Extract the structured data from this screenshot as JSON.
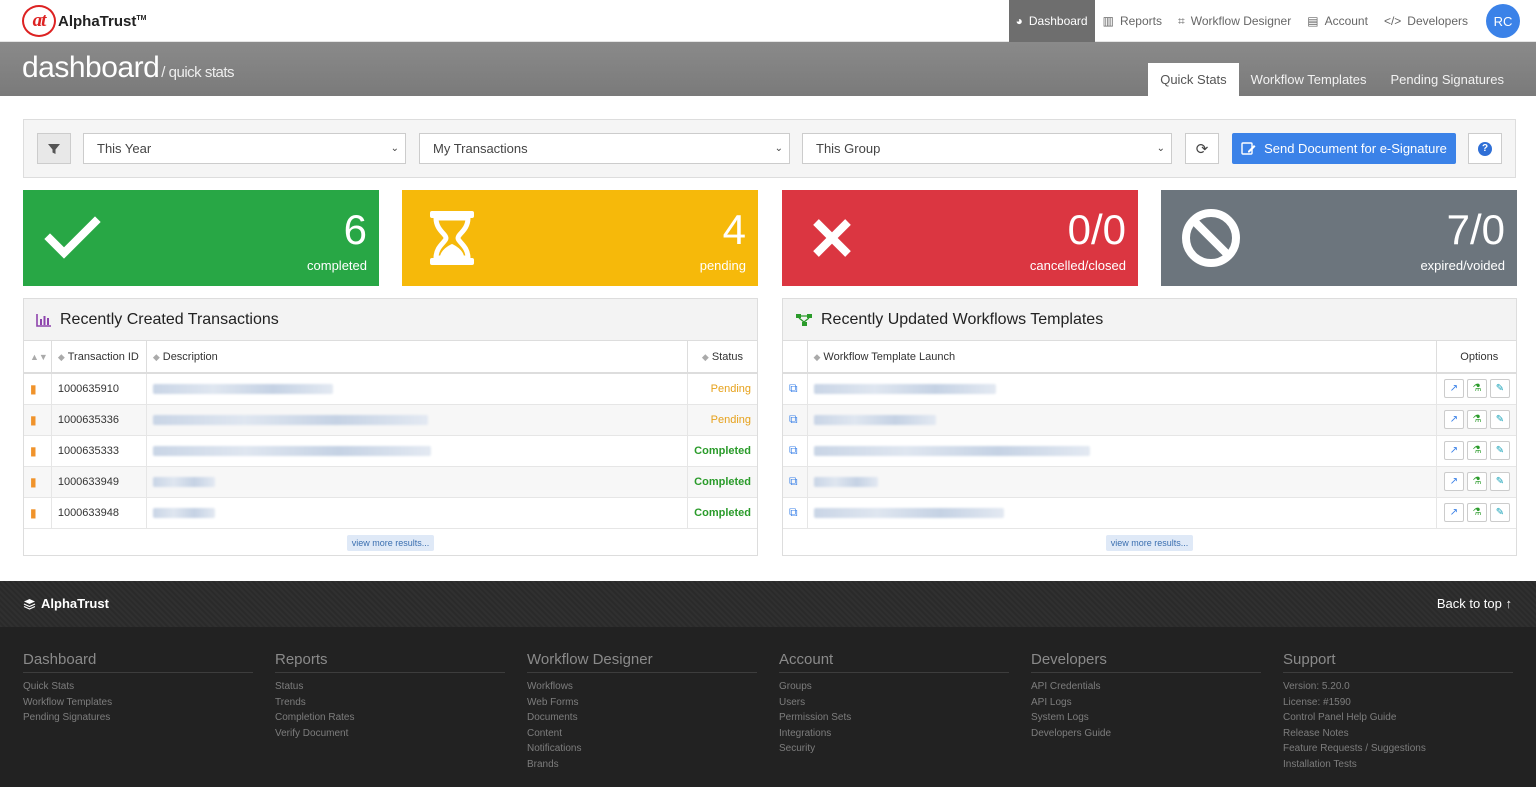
{
  "brand": {
    "name": "AlphaTrust",
    "tm": "TM",
    "logo_glyph": "at"
  },
  "nav": {
    "items": [
      {
        "label": "Dashboard",
        "icon": "gauge-icon",
        "active": true
      },
      {
        "label": "Reports",
        "icon": "bar-chart-icon"
      },
      {
        "label": "Workflow Designer",
        "icon": "crop-icon"
      },
      {
        "label": "Account",
        "icon": "building-icon"
      },
      {
        "label": "Developers",
        "icon": "code-icon"
      }
    ],
    "avatar": "RC"
  },
  "header": {
    "title": "dashboard",
    "subtitle": "/ quick stats",
    "tabs": [
      "Quick Stats",
      "Workflow Templates",
      "Pending Signatures"
    ]
  },
  "filters": {
    "period": "This Year",
    "scope": "My Transactions",
    "group": "This Group",
    "send_label": "Send Document for e-Signature"
  },
  "stats": [
    {
      "value": "6",
      "label": "completed",
      "color": "#28a745",
      "icon": "check-icon"
    },
    {
      "value": "4",
      "label": "pending",
      "color": "#f6b90a",
      "icon": "hourglass-icon"
    },
    {
      "value": "0/0",
      "label": "cancelled/closed",
      "color": "#db3641",
      "icon": "times-icon"
    },
    {
      "value": "7/0",
      "label": "expired/voided",
      "color": "#6c757d",
      "icon": "ban-icon"
    }
  ],
  "transactions": {
    "title": "Recently Created Transactions",
    "columns": [
      "Transaction ID",
      "Description",
      "Status"
    ],
    "rows": [
      {
        "id": "1000635910",
        "status": "Pending"
      },
      {
        "id": "1000635336",
        "status": "Pending"
      },
      {
        "id": "1000635333",
        "status": "Completed"
      },
      {
        "id": "1000633949",
        "status": "Completed"
      },
      {
        "id": "1000633948",
        "status": "Completed"
      }
    ],
    "more": "view more results..."
  },
  "templates": {
    "title": "Recently Updated Workflows Templates",
    "columns": [
      "Workflow Template Launch",
      "Options"
    ],
    "more": "view more results..."
  },
  "footer": {
    "brand": "AlphaTrust",
    "back_to_top": "Back to top",
    "columns": [
      {
        "title": "Dashboard",
        "links": [
          "Quick Stats",
          "Workflow Templates",
          "Pending Signatures"
        ]
      },
      {
        "title": "Reports",
        "links": [
          "Status",
          "Trends",
          "Completion Rates",
          "Verify Document"
        ]
      },
      {
        "title": "Workflow Designer",
        "links": [
          "Workflows",
          "Web Forms",
          "Documents",
          "Content",
          "Notifications",
          "Brands"
        ]
      },
      {
        "title": "Account",
        "links": [
          "Groups",
          "Users",
          "Permission Sets",
          "Integrations",
          "Security"
        ]
      },
      {
        "title": "Developers",
        "links": [
          "API Credentials",
          "API Logs",
          "System Logs",
          "Developers Guide"
        ]
      },
      {
        "title": "Support",
        "links": [
          "Version: 5.20.0",
          "License: #1590",
          "Control Panel Help Guide",
          "Release Notes",
          "Feature Requests / Suggestions",
          "Installation Tests"
        ]
      }
    ]
  }
}
